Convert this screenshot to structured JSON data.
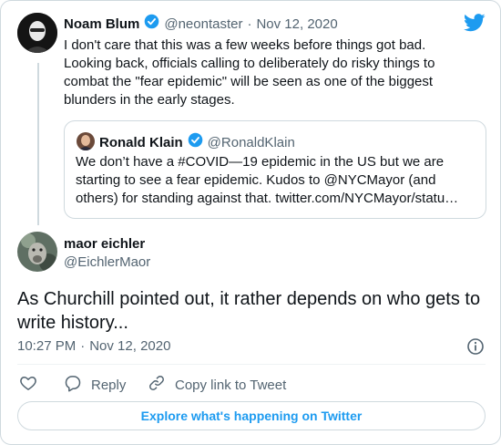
{
  "parent_tweet": {
    "author_name": "Noam Blum",
    "handle": "@neontaster",
    "separator": "·",
    "date": "Nov 12, 2020",
    "text": "I don't care that this was a few weeks before things got bad. Looking back, officials calling to deliberately do risky things to combat the \"fear epidemic\" will be seen as one of the biggest blunders in the early stages.",
    "quoted_tweet": {
      "author_name": "Ronald Klain",
      "handle": "@RonaldKlain",
      "text": "We don’t have a #COVID—19 epidemic in the US but we are starting to see a fear epidemic.  Kudos to @NYCMayor (and others) for standing against that. twitter.com/NYCMayor/statu…"
    }
  },
  "main_tweet": {
    "author_name": "maor eichler",
    "handle": "@EichlerMaor",
    "text": "As Churchill pointed out, it rather depends on who gets to write history...",
    "time": "10:27 PM",
    "separator": "·",
    "date": "Nov 12, 2020"
  },
  "actions": {
    "reply_label": "Reply",
    "copy_link_label": "Copy link to Tweet"
  },
  "explore_button": {
    "label": "Explore what's happening on Twitter"
  },
  "icons": {
    "brand": "twitter-bird-icon",
    "verified": "verified-badge-icon",
    "info": "info-icon",
    "like": "heart-icon",
    "reply": "reply-bubble-icon",
    "copy_link": "link-icon"
  },
  "colors": {
    "accent": "#1d9bf0",
    "muted": "#536471",
    "border": "#cfd9de"
  }
}
